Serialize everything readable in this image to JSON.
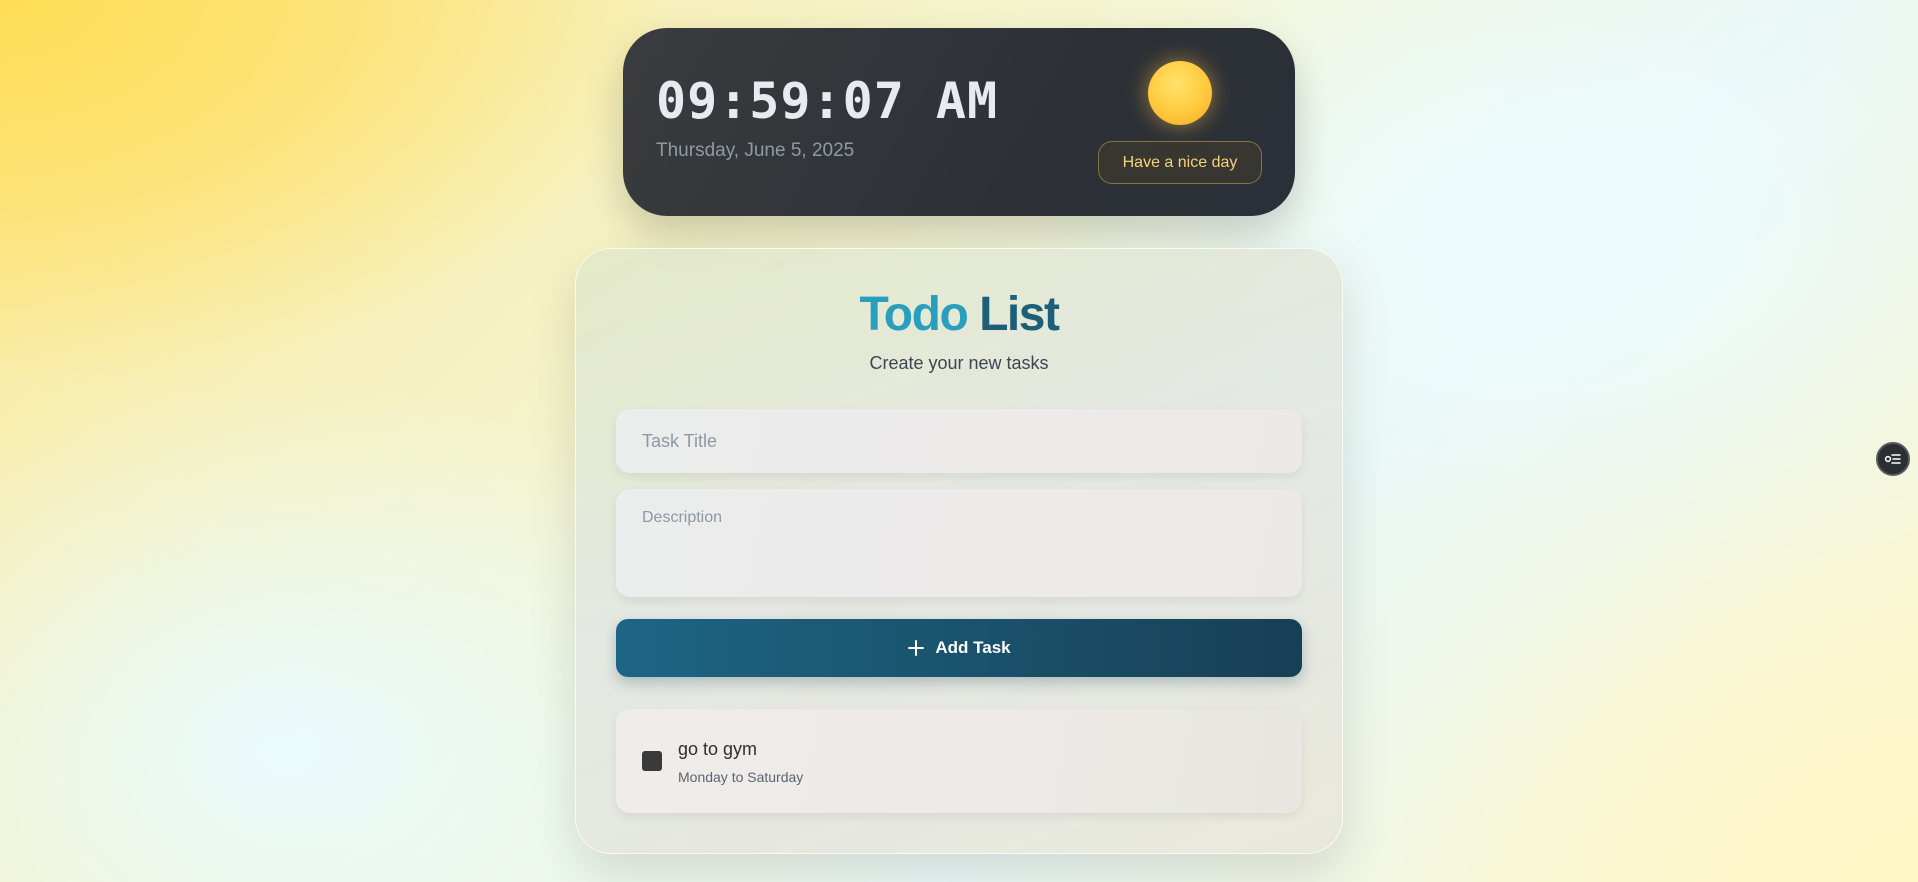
{
  "clock": {
    "time": "09:59:07 AM",
    "date": "Thursday, June 5, 2025",
    "greeting": "Have a nice day",
    "weather_icon": "sun-icon"
  },
  "todo": {
    "title_part1": "Todo",
    "title_part2": "List",
    "subtitle": "Create your new tasks",
    "title_placeholder": "Task Title",
    "description_placeholder": "Description",
    "add_button_label": "Add Task",
    "tasks": [
      {
        "title": "go to gym",
        "description": "Monday to Saturday",
        "completed": false
      }
    ]
  },
  "floating_button": {
    "icon": "filter-list-icon"
  },
  "colors": {
    "accent_light": "#2a9ebd",
    "accent_dark": "#1d5e78",
    "button": "#1a4f68",
    "clock_bg": "#2d3136",
    "greeting_text": "#f4d37a",
    "sun": "#ffc93d"
  }
}
